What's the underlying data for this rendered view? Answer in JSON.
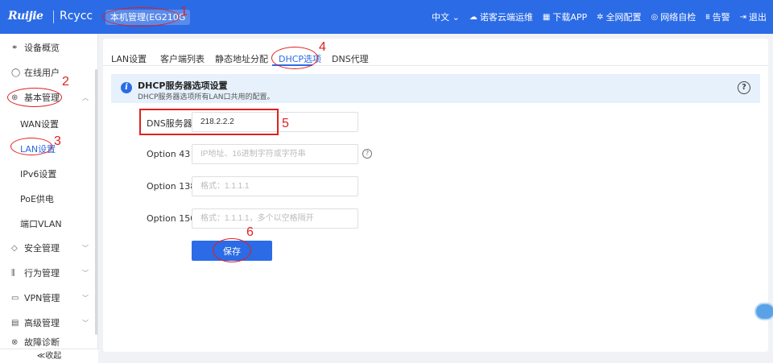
{
  "header": {
    "logo": "Ruijie",
    "logo2": "Rcycc",
    "device": "本机管理(EG210G",
    "right_items": [
      {
        "icon": "globe-lang-icon",
        "label": "中文 ⌄"
      },
      {
        "icon": "cloud-icon",
        "label": "诺客云端运维"
      },
      {
        "icon": "download-icon",
        "label": "下载APP"
      },
      {
        "icon": "network-icon",
        "label": "全网配置"
      },
      {
        "icon": "diagnose-icon",
        "label": "网络自检"
      },
      {
        "icon": "alarm-icon",
        "label": "告警"
      },
      {
        "icon": "logout-icon",
        "label": "退出"
      }
    ]
  },
  "sidebar": {
    "items": [
      {
        "label": "设备概览",
        "icon": "overview-icon"
      },
      {
        "label": "在线用户",
        "icon": "user-icon"
      },
      {
        "label": "基本管理",
        "icon": "globe-icon"
      },
      {
        "label": "安全管理",
        "icon": "shield-icon"
      },
      {
        "label": "行为管理",
        "icon": "chart-icon"
      },
      {
        "label": "VPN管理",
        "icon": "vpn-icon"
      },
      {
        "label": "高级管理",
        "icon": "advanced-icon"
      },
      {
        "label": "故障诊断",
        "icon": "diagnosis-icon"
      }
    ],
    "subitems": [
      "WAN设置",
      "LAN设置",
      "IPv6设置",
      "PoE供电",
      "端口VLAN"
    ],
    "collapse": "≪收起"
  },
  "tabs": [
    "LAN设置",
    "客户端列表",
    "静态地址分配",
    "DHCP选项",
    "DNS代理"
  ],
  "info": {
    "title": "DHCP服务器选项设置",
    "desc": "DHCP服务器选项所有LAN口共用的配置。"
  },
  "form": {
    "dns": {
      "label": "DNS服务器",
      "value": "218.2.2.2"
    },
    "opt43": {
      "label": "Option 43",
      "placeholder": "IP地址、16进制字符或字符串"
    },
    "opt138": {
      "label": "Option 138",
      "placeholder": "格式：1.1.1.1"
    },
    "opt150": {
      "label": "Option 150",
      "placeholder": "格式：1.1.1.1，多个以空格隔开"
    },
    "save": "保存"
  },
  "annotations": [
    "1",
    "2",
    "3",
    "4",
    "5",
    "6"
  ]
}
